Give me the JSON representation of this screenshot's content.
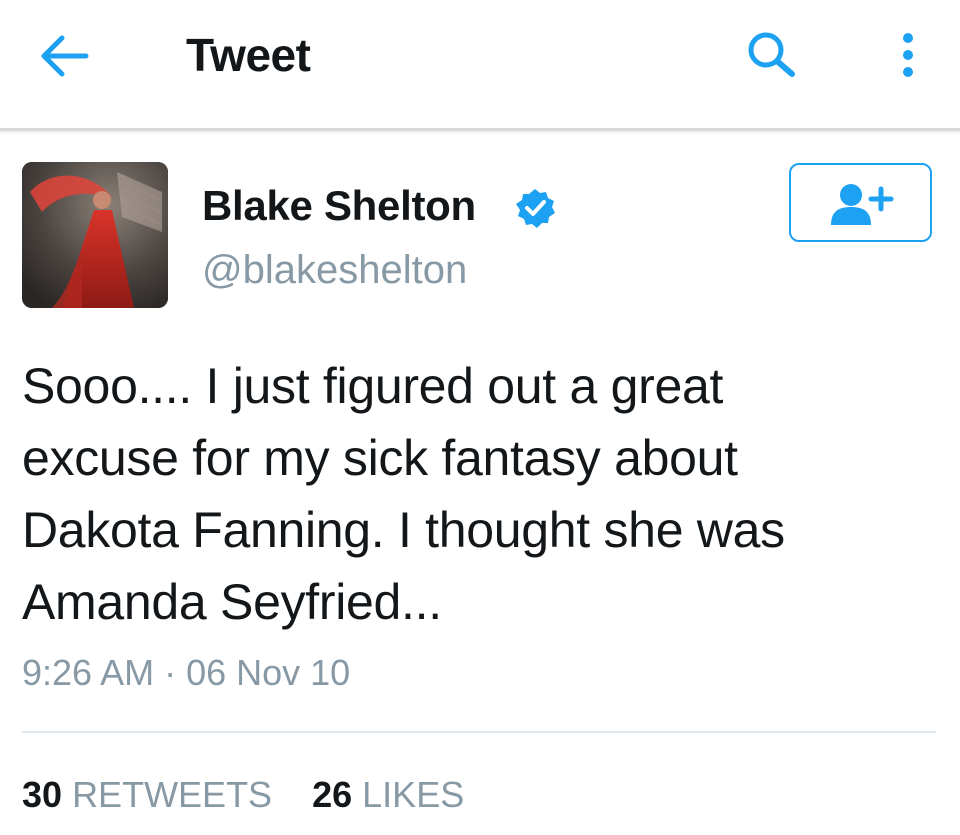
{
  "colors": {
    "accent": "#1da1f2",
    "text_primary": "#14171a",
    "text_secondary": "#8899a6",
    "divider": "#e1e8ed"
  },
  "header": {
    "title": "Tweet",
    "back_icon": "arrow-left-icon",
    "search_icon": "search-icon",
    "more_icon": "more-vertical-icon"
  },
  "author": {
    "name": "Blake Shelton",
    "handle": "@blakeshelton",
    "verified_icon": "verified-badge-icon",
    "follow_icon": "add-user-icon"
  },
  "tweet": {
    "text": "Sooo.... I just figured out a great\nexcuse for my sick fantasy about\nDakota Fanning. I thought she was\nAmanda Seyfried...",
    "timestamp": "9:26 AM · 06 Nov 10"
  },
  "stats": {
    "retweets_count": "30",
    "retweets_label": "RETWEETS",
    "likes_count": "26",
    "likes_label": "LIKES"
  }
}
